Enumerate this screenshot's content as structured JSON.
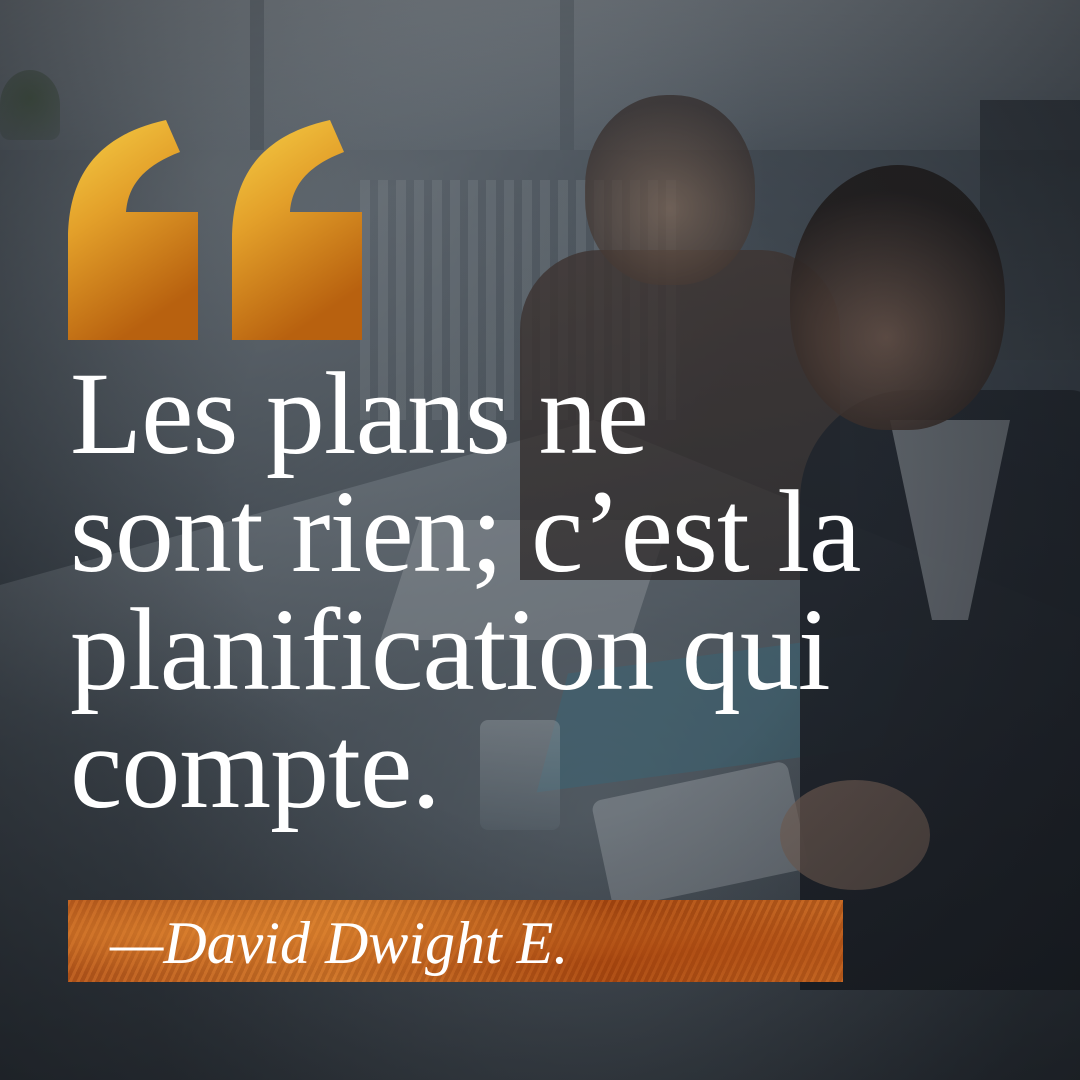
{
  "quote": {
    "lines": [
      "Les plans ne",
      "sont rien; c’est la",
      "planification qui",
      "compte."
    ]
  },
  "author": {
    "text": "—David Dwight E."
  },
  "colors": {
    "gold_light": "#f2c23a",
    "gold_dark": "#b8670f",
    "author_bar": "#c0601d",
    "text": "#ffffff"
  },
  "icons": {
    "quote_mark": "opening-quotation-mark-icon"
  }
}
